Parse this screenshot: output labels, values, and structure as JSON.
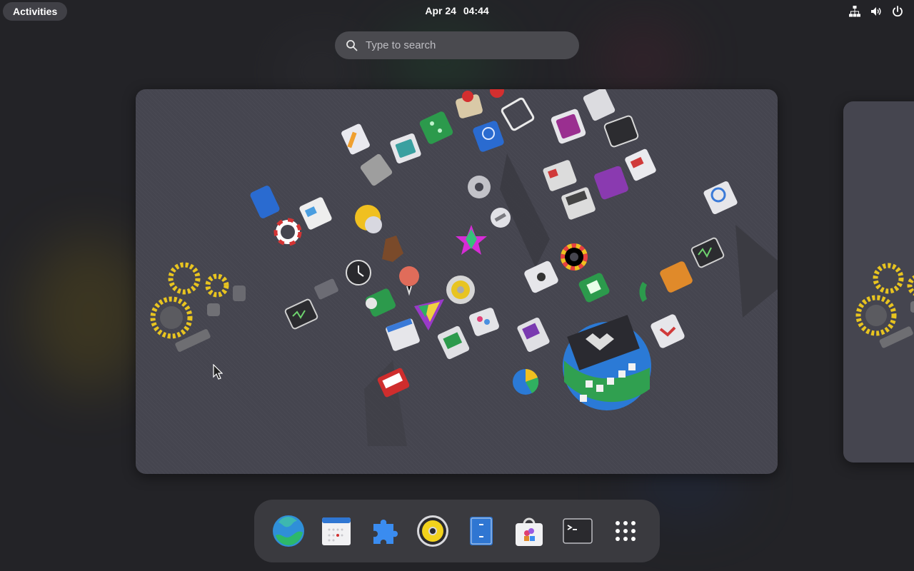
{
  "topbar": {
    "activities_label": "Activities",
    "date": "Apr 24",
    "time": "04:44",
    "tray_icons": [
      "network-icon",
      "volume-icon",
      "power-icon"
    ]
  },
  "search": {
    "placeholder": "Type to search"
  },
  "dash": {
    "apps": [
      {
        "name": "web-browser",
        "icon": "globe-icon"
      },
      {
        "name": "calendar",
        "icon": "calendar-icon"
      },
      {
        "name": "extensions",
        "icon": "puzzle-icon"
      },
      {
        "name": "music-player",
        "icon": "speaker-icon"
      },
      {
        "name": "files",
        "icon": "file-cabinet-icon"
      },
      {
        "name": "software",
        "icon": "shopping-bag-icon"
      },
      {
        "name": "terminal",
        "icon": "terminal-icon"
      },
      {
        "name": "show-apps",
        "icon": "app-grid-icon"
      }
    ]
  },
  "colors": {
    "background": "#232327",
    "panel_pill": "#404046",
    "search_field": "#4a4a4f",
    "dash": "#3a3a3f",
    "workspace": "#45454f"
  }
}
